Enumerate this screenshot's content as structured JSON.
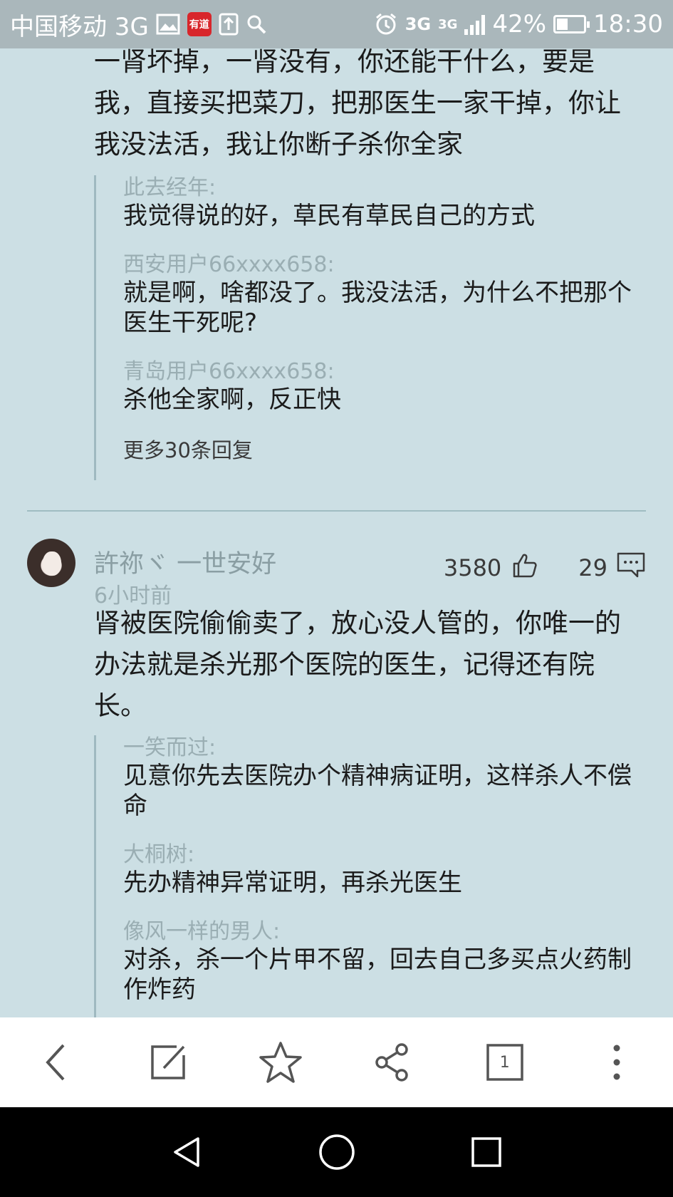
{
  "status_bar": {
    "carrier": "中国移动 3G",
    "app_badge": "有道",
    "net_1": "3G",
    "net_2": "3G",
    "battery_pct": "42%",
    "battery_level": 0.42,
    "time": "18:30"
  },
  "comments": [
    {
      "text": "一肾坏掉，一肾没有，你还能干什么，要是我，直接买把菜刀，把那医生一家干掉，你让我没法活，我让你断子杀你全家",
      "replies": [
        {
          "author": "此去经年:",
          "text": "我觉得说的好，草民有草民自己的方式"
        },
        {
          "author": "西安用户66xxxx658:",
          "text": "就是啊，啥都没了。我没法活，为什么不把那个医生干死呢?"
        },
        {
          "author": "青岛用户66xxxx658:",
          "text": "杀他全家啊，反正快"
        }
      ],
      "more_replies": "更多30条回复"
    },
    {
      "username": "許祢ヾ 一世安好",
      "time": "6小时前",
      "likes": "3580",
      "reply_count": "29",
      "text": "肾被医院偷偷卖了，放心没人管的，你唯一的办法就是杀光那个医院的医生，记得还有院长。",
      "replies": [
        {
          "author": "一笑而过:",
          "text": "见意你先去医院办个精神病证明，这样杀人不偿命"
        },
        {
          "author": "大桐树:",
          "text": "先办精神异常证明，再杀光医生"
        },
        {
          "author": "像风一样的男人:",
          "text": "对杀，杀一个片甲不留，回去自己多买点火药制作炸药"
        }
      ]
    }
  ],
  "toolbar": {
    "items": [
      {
        "icon": "back-chevron-icon"
      },
      {
        "icon": "edit-icon"
      },
      {
        "icon": "star-icon"
      },
      {
        "icon": "share-icon"
      },
      {
        "icon": "tabs-icon",
        "count": "1"
      },
      {
        "icon": "more-vertical-icon"
      }
    ]
  },
  "nav": {
    "items": [
      "back-triangle-icon",
      "home-circle-icon",
      "recents-square-icon"
    ]
  }
}
